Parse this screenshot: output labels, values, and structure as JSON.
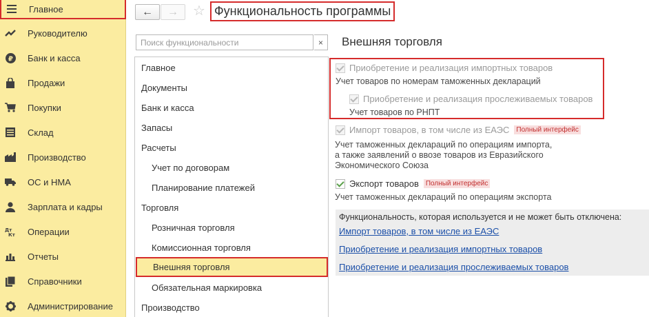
{
  "sidebar": {
    "items": [
      {
        "label": "Главное",
        "icon": "menu-icon"
      },
      {
        "label": "Руководителю",
        "icon": "trend-icon"
      },
      {
        "label": "Банк и касса",
        "icon": "ruble-icon"
      },
      {
        "label": "Продажи",
        "icon": "bag-icon"
      },
      {
        "label": "Покупки",
        "icon": "cart-icon"
      },
      {
        "label": "Склад",
        "icon": "warehouse-icon"
      },
      {
        "label": "Производство",
        "icon": "factory-icon"
      },
      {
        "label": "ОС и НМА",
        "icon": "truck-icon"
      },
      {
        "label": "Зарплата и кадры",
        "icon": "person-icon"
      },
      {
        "label": "Операции",
        "icon": "dt-kt-icon"
      },
      {
        "label": "Отчеты",
        "icon": "bar-chart-icon"
      },
      {
        "label": "Справочники",
        "icon": "books-icon"
      },
      {
        "label": "Администрирование",
        "icon": "gear-icon"
      }
    ]
  },
  "header": {
    "title": "Функциональность программы"
  },
  "search": {
    "placeholder": "Поиск функциональности",
    "clear_symbol": "×"
  },
  "sections": [
    {
      "label": "Главное"
    },
    {
      "label": "Документы"
    },
    {
      "label": "Банк и касса"
    },
    {
      "label": "Запасы"
    },
    {
      "label": "Расчеты"
    },
    {
      "label": "Учет по договорам"
    },
    {
      "label": "Планирование платежей"
    },
    {
      "label": "Торговля"
    },
    {
      "label": "Розничная торговля"
    },
    {
      "label": "Комиссионная торговля"
    },
    {
      "label": "Внешняя торговля"
    },
    {
      "label": "Обязательная маркировка"
    },
    {
      "label": "Производство"
    }
  ],
  "main": {
    "heading": "Внешняя торговля",
    "options": [
      {
        "label": "Приобретение и реализация импортных товаров",
        "checked": true,
        "disabled": true,
        "desc": "Учет товаров по номерам таможенных деклараций"
      },
      {
        "label": "Приобретение и реализация прослеживаемых товаров",
        "checked": true,
        "disabled": true,
        "desc": "Учет товаров по РНПТ"
      },
      {
        "label": "Импорт товаров, в том числе из ЕАЭС",
        "checked": true,
        "disabled": true,
        "badge": "Полный интерфейс",
        "desc_lines": [
          "Учет таможенных деклараций по операциям импорта,",
          "а также заявлений о ввозе товаров из Евразийского",
          "Экономического Союза"
        ]
      },
      {
        "label": "Экспорт товаров",
        "checked": true,
        "disabled": false,
        "badge": "Полный интерфейс",
        "desc": "Учет таможенных деклараций по операциям экспорта"
      }
    ],
    "info": {
      "text": "Функциональность, которая используется и не может быть отключена:",
      "links": [
        "Импорт товаров, в том числе из ЕАЭС",
        "Приобретение и реализация импортных товаров",
        "Приобретение и реализация прослеживаемых товаров"
      ]
    }
  },
  "colors": {
    "sidebar_bg": "#fbeca0",
    "highlight": "#d52b2b",
    "link": "#1b4fa8",
    "check": "#5ba04a",
    "badge_bg": "#f8dede",
    "badge_text": "#c23030"
  }
}
